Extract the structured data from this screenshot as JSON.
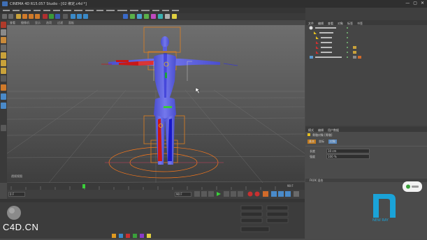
{
  "window": {
    "title": "CINEMA 4D R15.057 Studio - [02 绑定.c4d *]",
    "controls": [
      "—",
      "▢",
      "✕"
    ]
  },
  "viewport": {
    "menu": [
      "查看",
      "摄像机",
      "显示",
      "选项",
      "过滤",
      "面板"
    ],
    "corner_label": "透视视图"
  },
  "timeline": {
    "ticks": [
      "0",
      "5",
      "10",
      "15",
      "20",
      "25",
      "30",
      "35",
      "40",
      "45",
      "50",
      "55",
      "60",
      "65",
      "70",
      "75",
      "80",
      "85",
      "90"
    ],
    "current_frame": "0 F",
    "end_frame": "90 F"
  },
  "transport": {
    "start_field": "0 F",
    "end_field": "90 F"
  },
  "object_manager": {
    "tabs": [
      "文件",
      "编辑",
      "查看",
      "对象",
      "标签",
      "书签"
    ],
    "items": [
      "女性角色",
      "骨骼",
      "Hip",
      "Spine",
      "Leg_L",
      "Leg_R",
      "角色网格"
    ]
  },
  "attribute_manager": {
    "tabs": [
      "模式",
      "编辑",
      "用户数据"
    ],
    "object_label": "骨骼对象 [骨骼]",
    "section_tabs": [
      "基本",
      "坐标",
      "对象"
    ],
    "fields": [
      {
        "label": "长度",
        "value": "10 cm"
      },
      {
        "label": "强度",
        "value": "100 %"
      }
    ],
    "footer_label": "FK/IK 混合"
  },
  "watermark": {
    "text": "C4D.CN"
  },
  "brand": {
    "logo_text": "NEW RAY",
    "accent_color": "#1aa3d8"
  },
  "colors": {
    "mesh": "#5e62e0",
    "leg_red": "#c81818",
    "leg_blue": "#1818c8",
    "ground_orange": "#ff7a1a",
    "highlight_yellow": "#e6c020"
  }
}
